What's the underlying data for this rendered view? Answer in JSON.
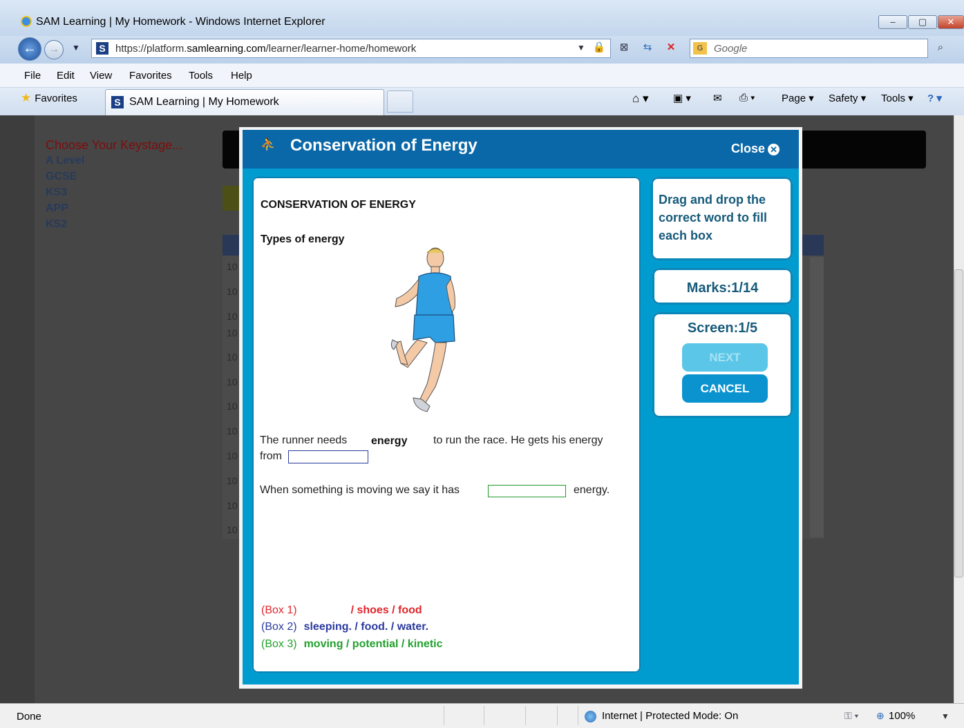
{
  "window": {
    "title": "SAM Learning | My Homework - Windows Internet Explorer"
  },
  "address": {
    "url_prefix": "https://platform.",
    "url_domain": "samlearning.com",
    "url_path": "/learner/learner-home/homework"
  },
  "search": {
    "placeholder": "Google"
  },
  "menu": [
    "File",
    "Edit",
    "View",
    "Favorites",
    "Tools",
    "Help"
  ],
  "favorites": {
    "label": "Favorites"
  },
  "tab": {
    "title": "SAM Learning | My Homework"
  },
  "commands": {
    "page": "Page ▾",
    "safety": "Safety ▾",
    "tools": "Tools ▾"
  },
  "background": {
    "choose": "Choose Your Keystage...",
    "keystages": [
      "A Level",
      "GCSE",
      "KS3",
      "APP",
      "KS2"
    ],
    "row_num": "10"
  },
  "modal": {
    "title": "Conservation of Energy",
    "close_label": "Close",
    "heading": "CONSERVATION OF ENERGY",
    "subheading": "Types of energy",
    "q1_a": "The runner needs",
    "q1_word": "energy",
    "q1_b": "to run the race. He gets his energy",
    "q1_c": "from",
    "q2_a": "When something is moving we say it has",
    "q2_b": "energy.",
    "options": [
      {
        "box": "(Box 1)",
        "words": "/ shoes / food",
        "color": "#e0262b"
      },
      {
        "box": "(Box 2)",
        "words": "sleeping. / food. / water.",
        "color": "#2b3a9e"
      },
      {
        "box": "(Box 3)",
        "words": "moving / potential / kinetic",
        "color": "#22a12e"
      }
    ],
    "instruction": "Drag and drop the correct word to fill each box",
    "marks": "Marks:1/14",
    "screen": "Screen:1/5",
    "next_label": "NEXT",
    "cancel_label": "CANCEL"
  },
  "status": {
    "text": "Done",
    "zone": "Internet | Protected Mode: On",
    "zoom": "100%"
  }
}
